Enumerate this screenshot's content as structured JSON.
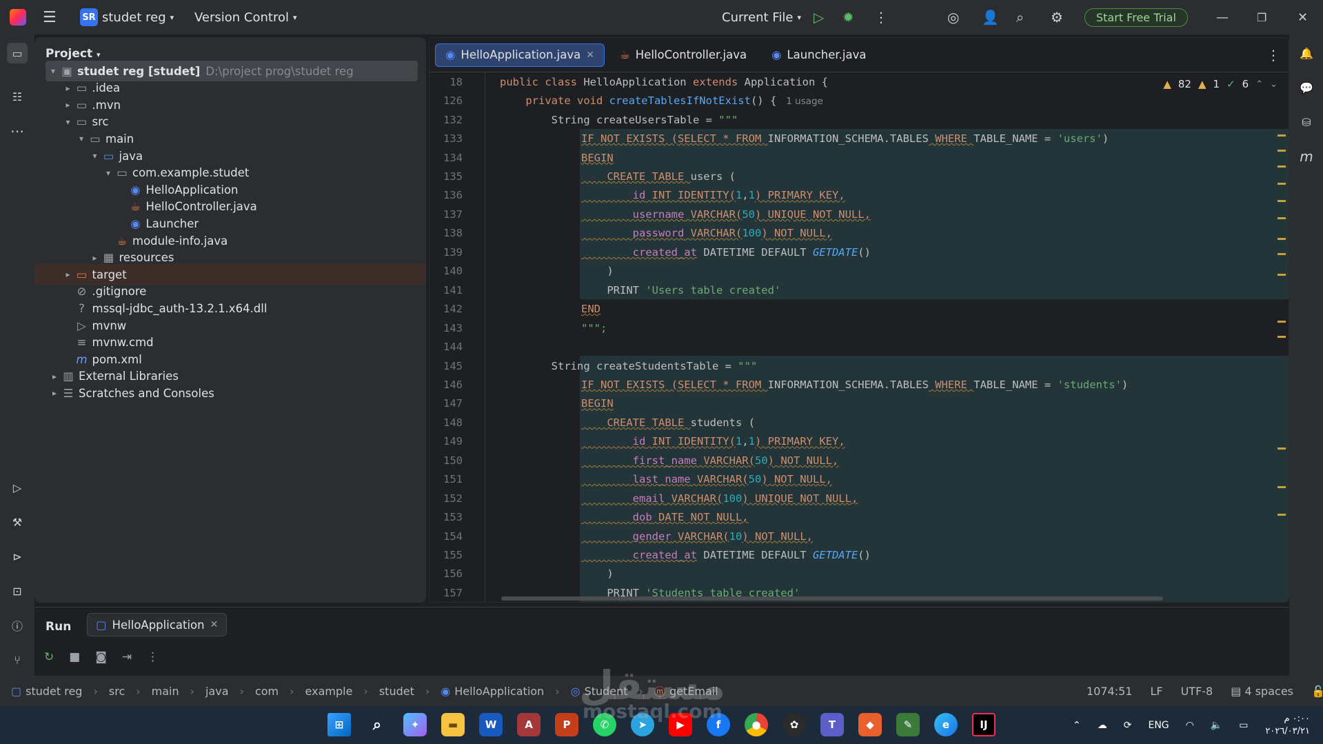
{
  "titlebar": {
    "project_badge": "SR",
    "project_name": "studet reg",
    "version_control": "Version Control",
    "run_config": "Current File",
    "trial_button": "Start Free Trial"
  },
  "project_panel": {
    "title": "Project",
    "tree": [
      {
        "label": "studet reg [studet]",
        "hint": "D:\\project prog\\studet reg",
        "icon": "folder-module-icon"
      },
      {
        "label": ".idea",
        "icon": "folder-icon"
      },
      {
        "label": ".mvn",
        "icon": "folder-icon"
      },
      {
        "label": "src",
        "icon": "folder-icon"
      },
      {
        "label": "main",
        "icon": "folder-icon"
      },
      {
        "label": "java",
        "icon": "folder-source-icon"
      },
      {
        "label": "com.example.studet",
        "icon": "package-icon"
      },
      {
        "label": "HelloApplication",
        "icon": "java-class-icon"
      },
      {
        "label": "HelloController.java",
        "icon": "java-file-icon"
      },
      {
        "label": "Launcher",
        "icon": "java-class-icon"
      },
      {
        "label": "module-info.java",
        "icon": "java-file-icon"
      },
      {
        "label": "resources",
        "icon": "folder-resources-icon"
      },
      {
        "label": "target",
        "icon": "folder-excluded-icon"
      },
      {
        "label": ".gitignore",
        "icon": "gitignore-icon"
      },
      {
        "label": "mssql-jdbc_auth-13.2.1.x64.dll",
        "icon": "unknown-file-icon"
      },
      {
        "label": "mvnw",
        "icon": "shell-file-icon"
      },
      {
        "label": "mvnw.cmd",
        "icon": "text-file-icon"
      },
      {
        "label": "pom.xml",
        "icon": "maven-icon"
      },
      {
        "label": "External Libraries",
        "icon": "libraries-icon"
      },
      {
        "label": "Scratches and Consoles",
        "icon": "scratches-icon"
      }
    ]
  },
  "editor": {
    "tabs": [
      {
        "label": "HelloApplication.java",
        "icon": "java-class-icon",
        "active": true
      },
      {
        "label": "HelloController.java",
        "icon": "java-file-icon",
        "active": false
      },
      {
        "label": "Launcher.java",
        "icon": "java-class-icon",
        "active": false
      }
    ],
    "inspections": {
      "warnings": "82",
      "weak_warnings": "1",
      "ok": "6"
    },
    "usage_hint": "1 usage",
    "line_numbers": [
      "18",
      "126",
      "132",
      "133",
      "134",
      "135",
      "136",
      "137",
      "138",
      "139",
      "140",
      "141",
      "142",
      "143",
      "144",
      "145",
      "146",
      "147",
      "148",
      "149",
      "150",
      "151",
      "152",
      "153",
      "154",
      "155",
      "156",
      "157"
    ],
    "lines": {
      "l18": {
        "a": "public class ",
        "b": "HelloApplication",
        "c": " extends ",
        "d": "Application",
        "e": " {"
      },
      "l126": {
        "a": "    private void ",
        "b": "createTablesIfNotExist",
        "c": "() {"
      },
      "l132": {
        "a": "        String createUsersTable = ",
        "b": "\"\"\""
      },
      "l133": {
        "a": "IF NOT EXISTS (SELECT * FROM ",
        "b": "INFORMATION_SCHEMA.TABLES",
        "c": " WHERE ",
        "d": "TABLE_NAME",
        "e": " = ",
        "f": "'users'",
        "g": ")"
      },
      "l134": {
        "a": "BEGIN"
      },
      "l135": {
        "a": "    CREATE TABLE ",
        "b": "users",
        "c": " ("
      },
      "l136": {
        "a": "        id",
        "b": " INT IDENTITY(",
        "c": "1",
        "d": ",",
        "e": "1",
        "f": ") PRIMARY KEY,"
      },
      "l137": {
        "a": "        username",
        "b": " VARCHAR(",
        "c": "50",
        "d": ") UNIQUE NOT NULL,"
      },
      "l138": {
        "a": "        password",
        "b": " VARCHAR(",
        "c": "100",
        "d": ") NOT NULL,"
      },
      "l139": {
        "a": "        created_at",
        "b": " DATETIME DEFAULT ",
        "c": "GETDATE",
        "d": "()"
      },
      "l140": {
        "a": "    )"
      },
      "l141": {
        "a": "    PRINT ",
        "b": "'Users table created'"
      },
      "l142": {
        "a": "END"
      },
      "l143": {
        "a": "\"\"\";"
      },
      "l145": {
        "a": "        String createStudentsTable = ",
        "b": "\"\"\""
      },
      "l146": {
        "a": "IF NOT EXISTS (SELECT * FROM ",
        "b": "INFORMATION_SCHEMA.TABLES",
        "c": " WHERE ",
        "d": "TABLE_NAME",
        "e": " = ",
        "f": "'students'",
        "g": ")"
      },
      "l147": {
        "a": "BEGIN"
      },
      "l148": {
        "a": "    CREATE TABLE ",
        "b": "students",
        "c": " ("
      },
      "l149": {
        "a": "        id",
        "b": " INT IDENTITY(",
        "c": "1",
        "d": ",",
        "e": "1",
        "f": ") PRIMARY KEY,"
      },
      "l150": {
        "a": "        first_name",
        "b": " VARCHAR(",
        "c": "50",
        "d": ") NOT NULL,"
      },
      "l151": {
        "a": "        last_name",
        "b": " VARCHAR(",
        "c": "50",
        "d": ") NOT NULL,"
      },
      "l152": {
        "a": "        email",
        "b": " VARCHAR(",
        "c": "100",
        "d": ") UNIQUE NOT NULL,"
      },
      "l153": {
        "a": "        dob",
        "b": " DATE NOT NULL,"
      },
      "l154": {
        "a": "        gender",
        "b": " VARCHAR(",
        "c": "10",
        "d": ") NOT NULL,"
      },
      "l155": {
        "a": "        created_at",
        "b": " DATETIME DEFAULT ",
        "c": "GETDATE",
        "d": "()"
      },
      "l156": {
        "a": "    )"
      },
      "l157": {
        "a": "    PRINT ",
        "b": "'Students table created'"
      }
    }
  },
  "run_panel": {
    "title": "Run",
    "tab": "HelloApplication"
  },
  "statusbar": {
    "breadcrumbs": [
      "studet reg",
      "src",
      "main",
      "java",
      "com",
      "example",
      "studet",
      "HelloApplication",
      "Student",
      "getEmail"
    ],
    "position": "1074:51",
    "line_sep": "LF",
    "encoding": "UTF-8",
    "indent": "4 spaces"
  },
  "taskbar": {
    "language": "ENG",
    "time": "٠:٠٠ م",
    "date": "٢٠٢٦/٠٣/٢١"
  },
  "watermark": {
    "text": "مستقل",
    "url": "mostaql.com"
  },
  "colors": {
    "accent": "#3574f0",
    "trial_green": "#4e8a45",
    "warning": "#e0b04e"
  }
}
